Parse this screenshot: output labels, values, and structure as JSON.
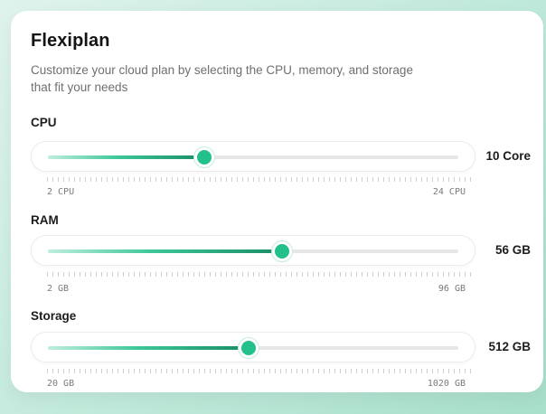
{
  "card": {
    "title": "Flexiplan",
    "description": "Customize your cloud plan by selecting the CPU, memory, and storage that fit your needs"
  },
  "sliders": {
    "cpu": {
      "label": "CPU",
      "value_text": "10 Core",
      "min_label": "2 CPU",
      "max_label": "24 CPU",
      "fraction": 0.38
    },
    "ram": {
      "label": "RAM",
      "value_text": "56 GB",
      "min_label": "2 GB",
      "max_label": "96 GB",
      "fraction": 0.57
    },
    "storage": {
      "label": "Storage",
      "value_text": "512 GB",
      "min_label": "20 GB",
      "max_label": "1020 GB",
      "fraction": 0.49
    }
  },
  "colors": {
    "accent": "#22c08b",
    "accent_dark": "#1a8c66",
    "background": "#bfe9da"
  }
}
